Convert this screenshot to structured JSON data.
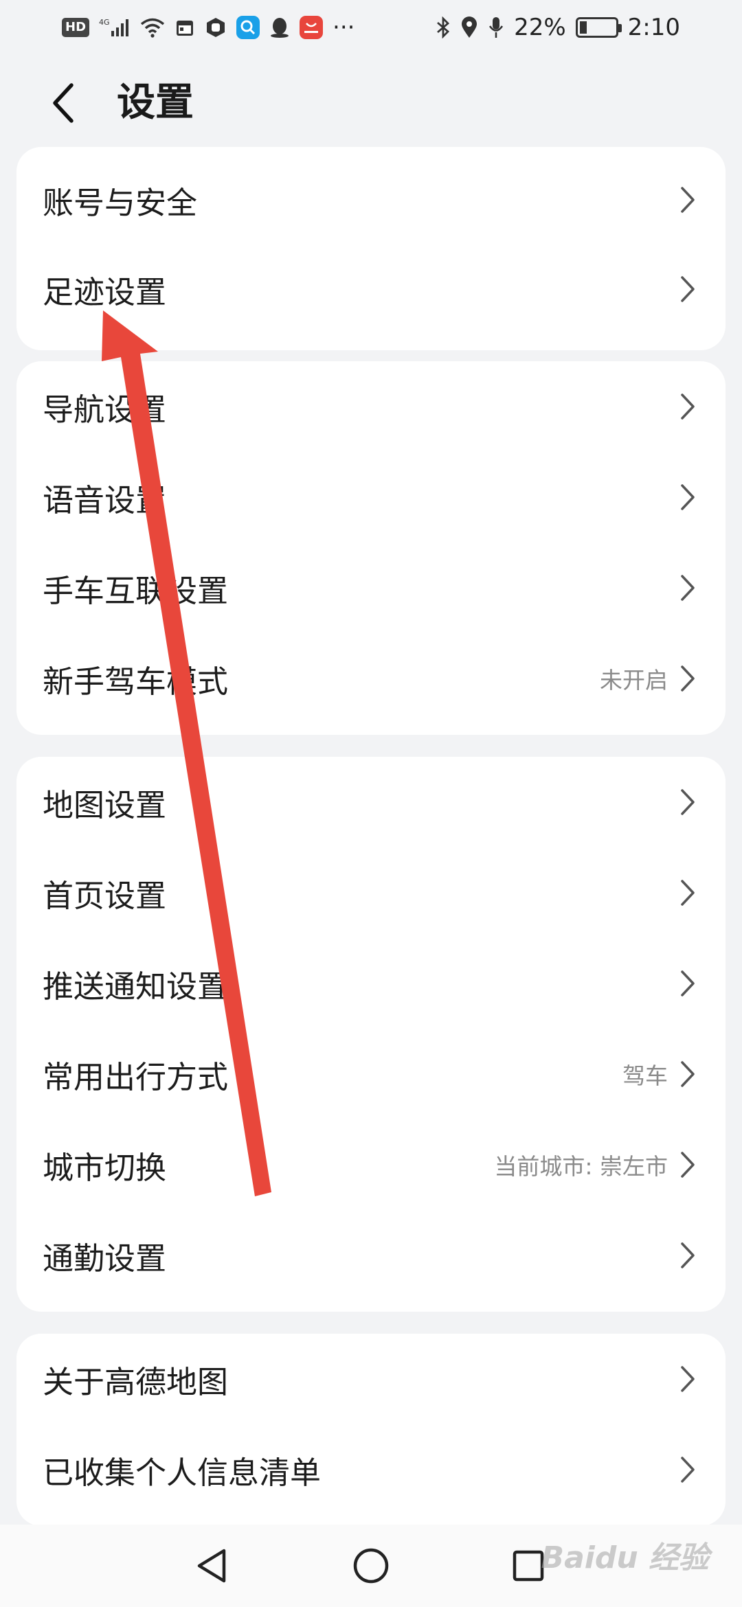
{
  "status_bar": {
    "hd": "HD",
    "network": "4G",
    "battery_percent": "22%",
    "battery_level": 0.22,
    "time": "2:10",
    "more": "···"
  },
  "header": {
    "title": "设置",
    "back_icon": "chevron-left-icon"
  },
  "groups": [
    {
      "items": [
        {
          "label": "账号与安全",
          "value": ""
        },
        {
          "label": "足迹设置",
          "value": ""
        }
      ]
    },
    {
      "items": [
        {
          "label": "导航设置",
          "value": ""
        },
        {
          "label": "语音设置",
          "value": ""
        },
        {
          "label": "手车互联设置",
          "value": ""
        },
        {
          "label": "新手驾车模式",
          "value": "未开启"
        }
      ]
    },
    {
      "items": [
        {
          "label": "地图设置",
          "value": ""
        },
        {
          "label": "首页设置",
          "value": ""
        },
        {
          "label": "推送通知设置",
          "value": ""
        },
        {
          "label": "常用出行方式",
          "value": "驾车"
        },
        {
          "label": "城市切换",
          "value": "当前城市: 崇左市"
        },
        {
          "label": "通勤设置",
          "value": ""
        }
      ]
    },
    {
      "items": [
        {
          "label": "关于高德地图",
          "value": ""
        },
        {
          "label": "已收集个人信息清单",
          "value": ""
        }
      ]
    }
  ],
  "nav_bar": {
    "back_icon": "triangle-back-icon",
    "home_icon": "circle-home-icon",
    "recents_icon": "square-recents-icon"
  },
  "watermark": "Baidu 经验",
  "colors": {
    "background": "#f2f3f5",
    "card": "#ffffff",
    "annotation_arrow": "#e8473b",
    "secondary_text": "#8a8a8a"
  }
}
